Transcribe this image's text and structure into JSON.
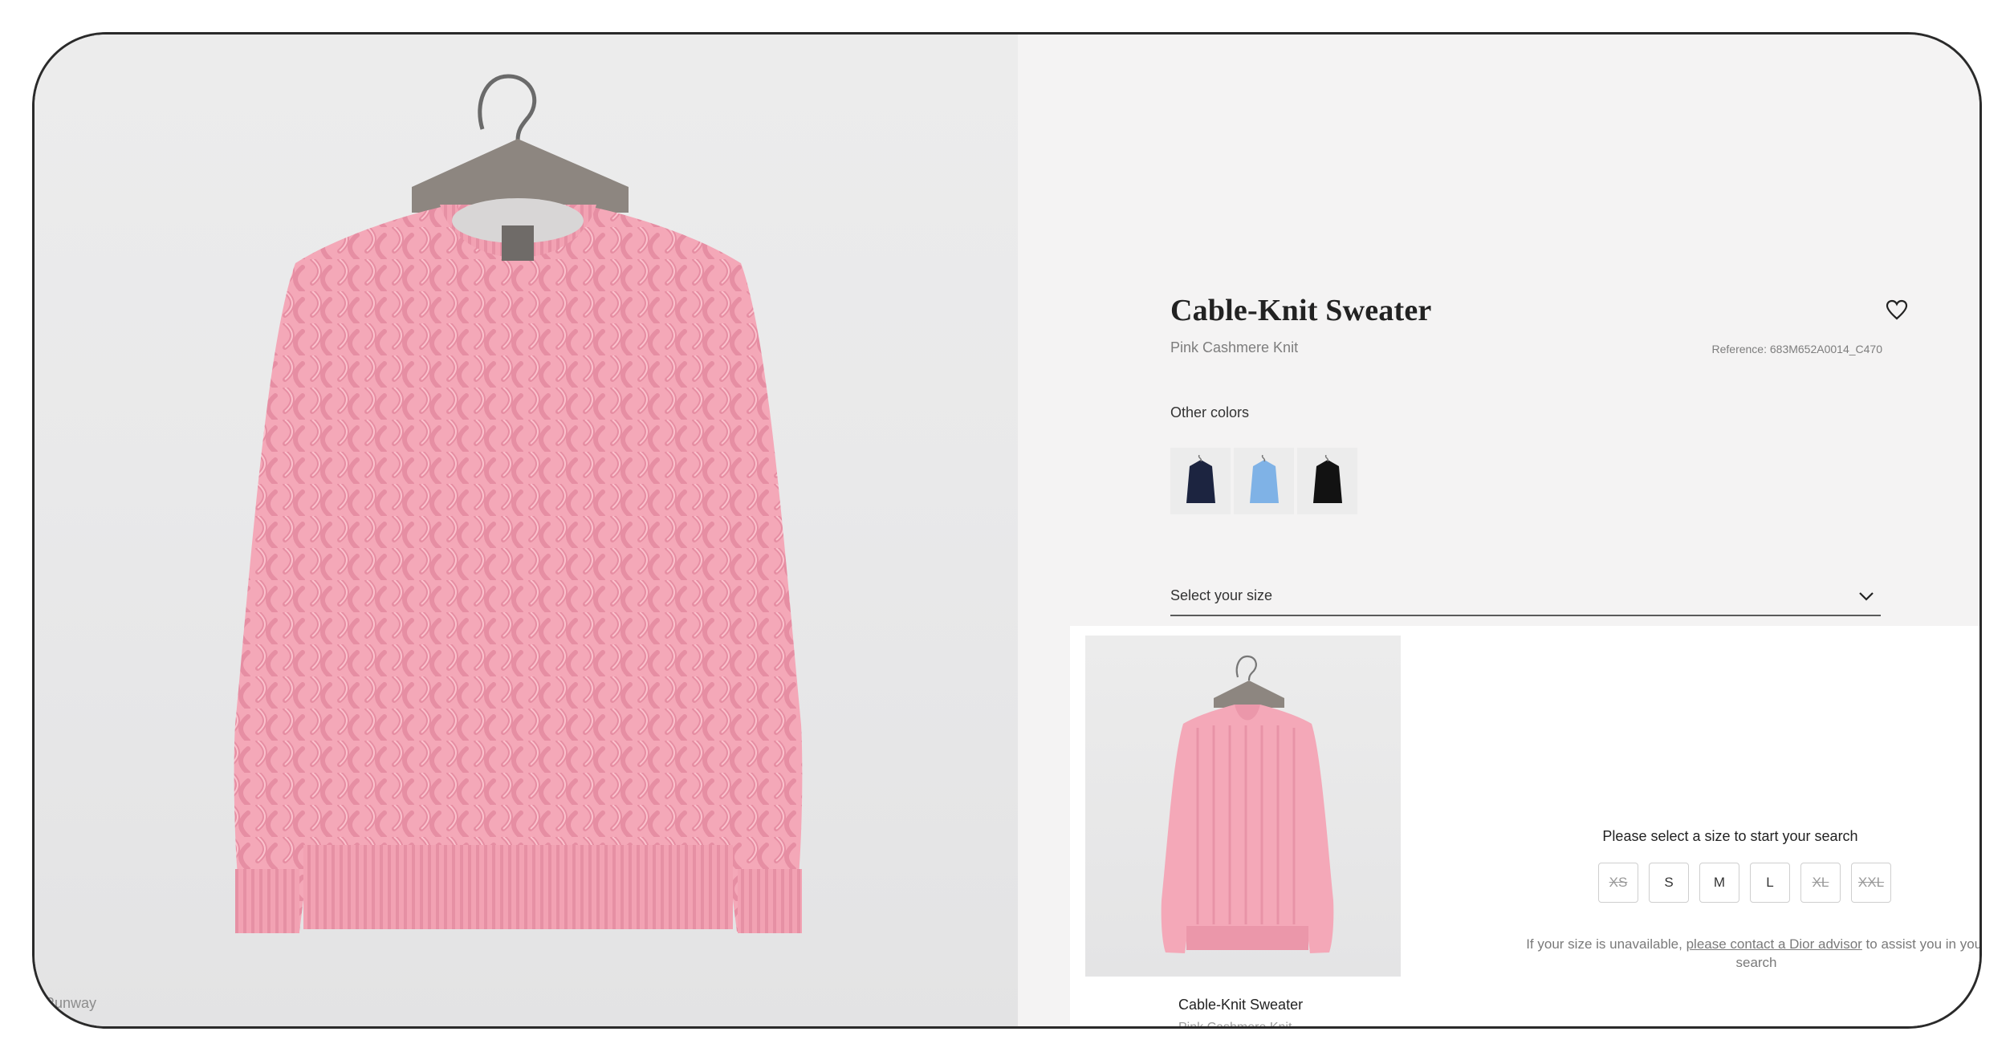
{
  "hero": {
    "caption": "Runway"
  },
  "product": {
    "title": "Cable-Knit Sweater",
    "subtitle": "Pink Cashmere Knit",
    "reference": "Reference: 683M652A0014_C470"
  },
  "colors": {
    "label": "Other colors",
    "swatches": [
      {
        "name": "navy",
        "color": "#1c2440"
      },
      {
        "name": "light-blue",
        "color": "#7fb2e6"
      },
      {
        "name": "black",
        "color": "#121212"
      }
    ],
    "product_color": "#f2a3b4"
  },
  "size_select": {
    "label": "Select your size"
  },
  "size_panel": {
    "thumb_title": "Cable-Knit Sweater",
    "thumb_subtitle": "Pink Cashmere Knit",
    "prompt": "Please select a size to start your search",
    "sizes": [
      {
        "label": "XS",
        "available": false
      },
      {
        "label": "S",
        "available": true
      },
      {
        "label": "M",
        "available": true
      },
      {
        "label": "L",
        "available": true
      },
      {
        "label": "XL",
        "available": false
      },
      {
        "label": "XXL",
        "available": false
      }
    ],
    "help_before": "If your size is unavailable, ",
    "help_link": "please contact a Dior advisor",
    "help_after": " to assist you in your search"
  }
}
